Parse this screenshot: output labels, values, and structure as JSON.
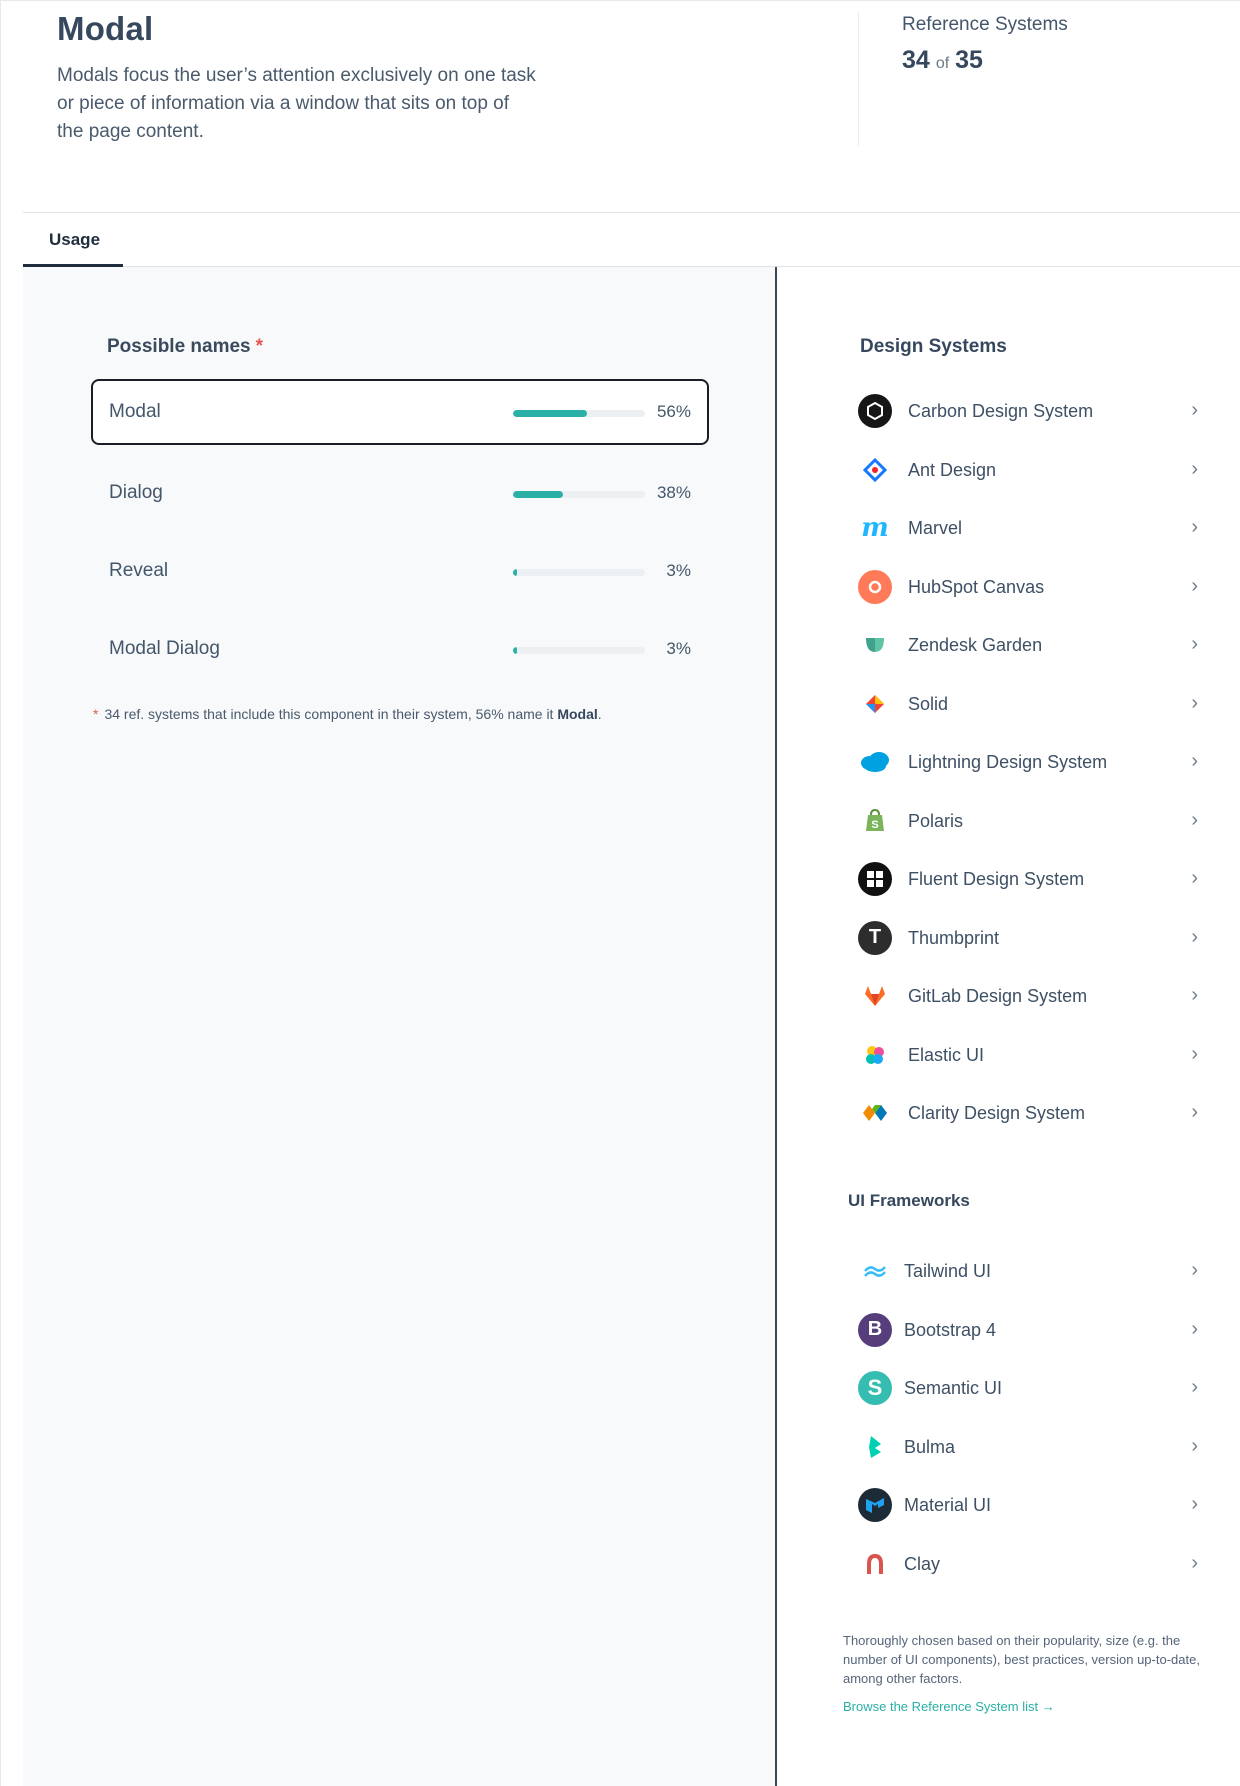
{
  "header": {
    "title": "Modal",
    "description": "Modals focus the user’s attention exclusively on one task or piece of information via a window that sits on top of the page content.",
    "reference_label": "Reference Systems",
    "reference_count": "34",
    "reference_of": "of",
    "reference_total": "35"
  },
  "tabs": [
    {
      "label": "Usage",
      "active": true
    }
  ],
  "possible_names": {
    "title": "Possible names",
    "required_mark": "*",
    "items": [
      {
        "name": "Modal",
        "percent": 56,
        "percent_label": "56%",
        "selected": true
      },
      {
        "name": "Dialog",
        "percent": 38,
        "percent_label": "38%",
        "selected": false
      },
      {
        "name": "Reveal",
        "percent": 3,
        "percent_label": "3%",
        "selected": false
      },
      {
        "name": "Modal Dialog",
        "percent": 3,
        "percent_label": "3%",
        "selected": false
      }
    ],
    "footnote_mark": "*",
    "footnote_text": "34 ref. systems that include this component in their system, 56% name it ",
    "footnote_bold": "Modal",
    "footnote_end": "."
  },
  "design_systems": {
    "title": "Design Systems",
    "items": [
      {
        "label": "Carbon Design System",
        "icon": "carbon-icon",
        "color": "#161616"
      },
      {
        "label": "Ant Design",
        "icon": "ant-design-icon",
        "color": "#1677ff"
      },
      {
        "label": "Marvel",
        "icon": "marvel-icon",
        "color": "#1fb6ff"
      },
      {
        "label": "HubSpot Canvas",
        "icon": "hubspot-icon",
        "color": "#ff7a59"
      },
      {
        "label": "Zendesk Garden",
        "icon": "zendesk-icon",
        "color": "#3fa38c"
      },
      {
        "label": "Solid",
        "icon": "solid-icon",
        "color": "#e53935"
      },
      {
        "label": "Lightning Design System",
        "icon": "salesforce-cloud-icon",
        "color": "#00a1e0"
      },
      {
        "label": "Polaris",
        "icon": "shopify-bag-icon",
        "color": "#7ab55c"
      },
      {
        "label": "Fluent Design System",
        "icon": "windows-icon",
        "color": "#111111"
      },
      {
        "label": "Thumbprint",
        "icon": "thumbprint-icon",
        "color": "#2d2d2d"
      },
      {
        "label": "GitLab Design System",
        "icon": "gitlab-fox-icon",
        "color": "#fc6d26"
      },
      {
        "label": "Elastic UI",
        "icon": "elastic-icon",
        "color": "#f04e98"
      },
      {
        "label": "Clarity Design System",
        "icon": "clarity-icon",
        "color": "#0079b8"
      }
    ]
  },
  "ui_frameworks": {
    "title": "UI Frameworks",
    "items": [
      {
        "label": "Tailwind UI",
        "icon": "tailwind-icon",
        "color": "#38bdf8"
      },
      {
        "label": "Bootstrap 4",
        "icon": "bootstrap-icon",
        "color": "#563d7c"
      },
      {
        "label": "Semantic UI",
        "icon": "semantic-icon",
        "color": "#35bdb2"
      },
      {
        "label": "Bulma",
        "icon": "bulma-icon",
        "color": "#00d1b2"
      },
      {
        "label": "Material UI",
        "icon": "material-ui-icon",
        "color": "#1c2b36"
      },
      {
        "label": "Clay",
        "icon": "clay-icon",
        "color": "#d9534f"
      }
    ]
  },
  "note": "Thoroughly chosen based on their popularity, size (e.g. the number of UI components), best practices, version up-to-date, among other factors.",
  "browse_link": "Browse the Reference System list →"
}
